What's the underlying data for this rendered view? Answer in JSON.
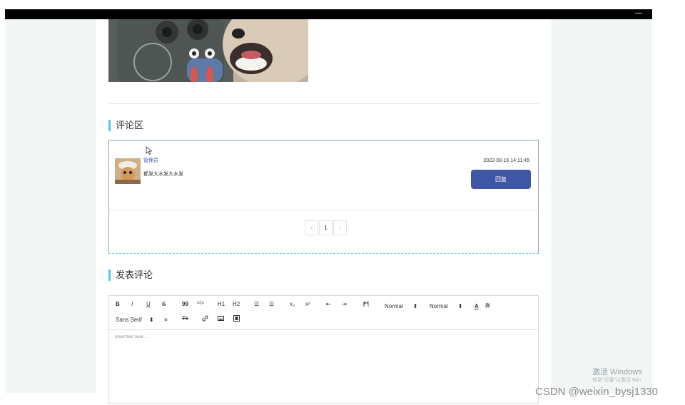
{
  "window": {
    "control_glyph": "—"
  },
  "sections": {
    "comments_title": "评论区",
    "post_title": "发表评论"
  },
  "comment": {
    "user": "管理员",
    "text": "都发大水发大水发",
    "time": "2022-03-16 14:11:45",
    "reply_label": "回复"
  },
  "pagination": {
    "prev": "‹",
    "page": "1",
    "next": "›"
  },
  "editor": {
    "toolbar": {
      "bold": "B",
      "italic": "I",
      "underline": "U",
      "strike": "S",
      "quote": "99",
      "code": "</>",
      "h1": "H1",
      "h2": "H2",
      "ordered_list": "☰",
      "bullet_list": "☰",
      "sub": "x₂",
      "sup": "x²",
      "indent": "⇤",
      "outdent": "⇥",
      "direction": "⁋¶",
      "size": "Normal",
      "header": "Normal",
      "font": "Sans Serif",
      "color": "A",
      "background": "A",
      "align": "≡",
      "clean": "Tx"
    },
    "placeholder": "Insert text here ..."
  },
  "watermark": {
    "line1": "激活 Windows",
    "line2": "转到\"设置\"以激活 Win",
    "csdn": "CSDN @weixin_bysj1330"
  }
}
